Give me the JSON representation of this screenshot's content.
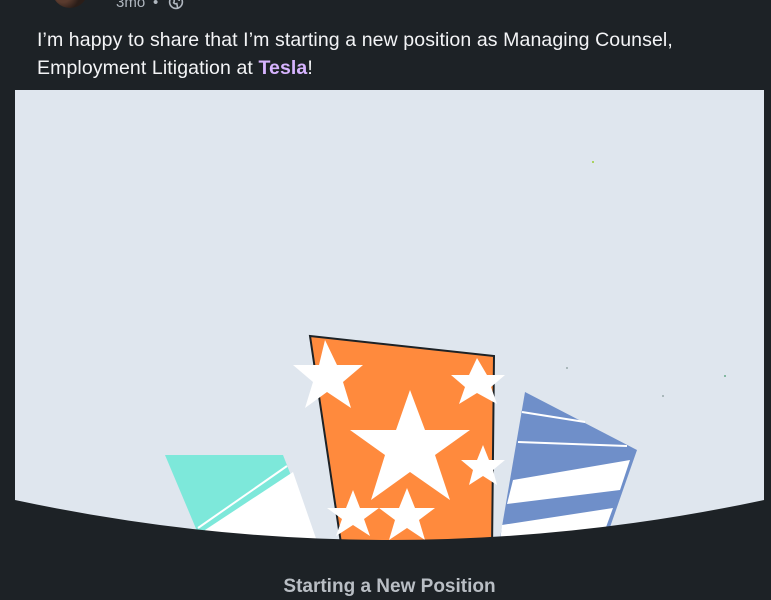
{
  "post": {
    "time_ago": "3mo",
    "separator": "•",
    "visibility_icon": "globe-icon",
    "text_before": "I’m happy to share that I’m starting a new position as Managing Counsel, Employment Litigation at ",
    "company": "Tesla",
    "text_after": "!"
  },
  "card": {
    "caption": "Starting a New Position",
    "illustration": "confetti-party-cups",
    "colors": {
      "background": "#dfe6ee",
      "orange_cup": "#ff8a3d",
      "teal_cup": "#7de8da",
      "blue_cup": "#6f8fc9",
      "ground": "#1d2226"
    }
  }
}
